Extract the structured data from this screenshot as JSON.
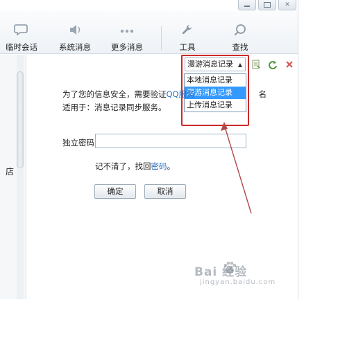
{
  "toolbar": {
    "items": [
      {
        "label": "临时会话",
        "icon": "chat-bubble-icon"
      },
      {
        "label": "系统消息",
        "icon": "speaker-icon"
      },
      {
        "label": "更多消息",
        "icon": "more-dots-icon"
      },
      {
        "label": "工具",
        "icon": "wrench-icon"
      },
      {
        "label": "查找",
        "icon": "search-icon"
      }
    ]
  },
  "left_pane": {
    "partial_text": "店"
  },
  "record_selector": {
    "selected": "漫游消息记录",
    "options": [
      "本地消息记录",
      "漫游消息记录",
      "上传消息记录"
    ]
  },
  "message": {
    "line1_prefix": "为了您的信息安全，需要验证",
    "line1_link": "QQ服务",
    "line1_suffix": "名",
    "line2": "适用于：消息记录同步服务。"
  },
  "form": {
    "password_label": "独立密码",
    "password_value": "",
    "forgot_prefix": "记不清了，找回",
    "forgot_link": "密码",
    "forgot_suffix": "。",
    "confirm_label": "确定",
    "cancel_label": "取消"
  },
  "watermark": {
    "title": "Bai 经验",
    "sub": "jingyan.baidu.com"
  },
  "colors": {
    "highlight": "#cc2a2a",
    "link": "#2a6fbe",
    "selected_option": "#3399ff"
  }
}
